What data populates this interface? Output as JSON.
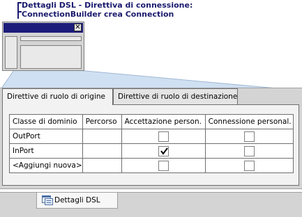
{
  "callout": {
    "line1": "Dettagli DSL - Direttiva di connessione:",
    "line2": "ConnectionBuilder crea Connection"
  },
  "mini_window": {
    "close_glyph": "✕"
  },
  "tabs": [
    {
      "label": "Direttive di ruolo di origine",
      "active": true
    },
    {
      "label": "Direttive di ruolo di destinazione",
      "active": false
    }
  ],
  "table": {
    "headers": [
      "Classe di dominio",
      "Percorso",
      "Accettazione person.",
      "Connessione personal."
    ],
    "rows": [
      {
        "domain_class": "OutPort",
        "path": "",
        "accept_custom": false,
        "connect_custom": false
      },
      {
        "domain_class": "InPort",
        "path": "",
        "accept_custom": true,
        "connect_custom": false
      },
      {
        "domain_class": "<Aggiungi nuova>",
        "path": "",
        "accept_custom": false,
        "connect_custom": false
      }
    ]
  },
  "bottom_tab": {
    "label": "Dettagli DSL",
    "icon": "dsl-details-icon"
  },
  "colors": {
    "callout": "#1a1a6e",
    "titlebar": "#1c1c7a",
    "panel": "#d4d4d4",
    "wedge": "#cfe0f2"
  }
}
